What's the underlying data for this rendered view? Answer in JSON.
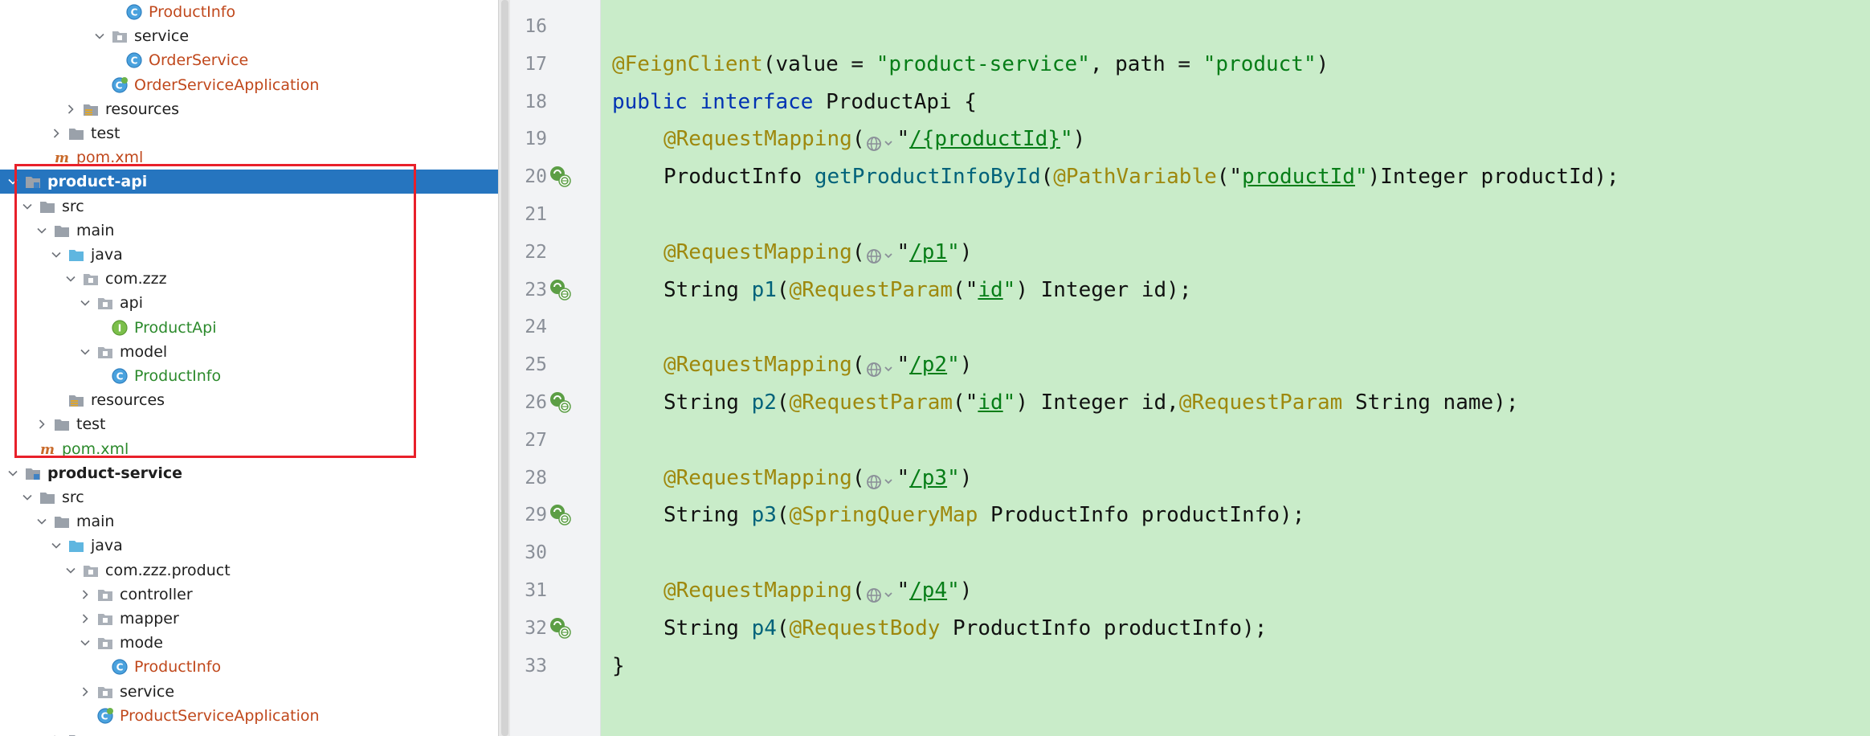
{
  "project_tree": {
    "rows": [
      {
        "label": "ProductInfo",
        "level": 7,
        "chevron": "none",
        "icon": "class-icon",
        "color": "cls-red"
      },
      {
        "label": "service",
        "level": 6,
        "chevron": "down",
        "icon": "package-icon",
        "color": "plain"
      },
      {
        "label": "OrderService",
        "level": 7,
        "chevron": "none",
        "icon": "class-icon",
        "color": "cls-red"
      },
      {
        "label": "OrderServiceApplication",
        "level": 6,
        "chevron": "none",
        "icon": "spring-app-icon",
        "color": "cls-red"
      },
      {
        "label": "resources",
        "level": 4,
        "chevron": "right",
        "icon": "resources-folder-icon",
        "color": "plain"
      },
      {
        "label": "test",
        "level": 3,
        "chevron": "right",
        "icon": "folder-icon",
        "color": "plain"
      },
      {
        "label": "pom.xml",
        "level": 2,
        "chevron": "none",
        "icon": "maven-icon",
        "color": "cls-red"
      },
      {
        "label": "product-api",
        "level": 0,
        "chevron": "down",
        "icon": "module-icon",
        "color": "plain",
        "selected": true,
        "bold": true
      },
      {
        "label": "src",
        "level": 1,
        "chevron": "down",
        "icon": "folder-icon",
        "color": "plain"
      },
      {
        "label": "main",
        "level": 2,
        "chevron": "down",
        "icon": "folder-icon",
        "color": "plain"
      },
      {
        "label": "java",
        "level": 3,
        "chevron": "down",
        "icon": "source-folder-icon",
        "color": "plain"
      },
      {
        "label": "com.zzz",
        "level": 4,
        "chevron": "down",
        "icon": "package-icon",
        "color": "plain"
      },
      {
        "label": "api",
        "level": 5,
        "chevron": "down",
        "icon": "package-icon",
        "color": "plain"
      },
      {
        "label": "ProductApi",
        "level": 6,
        "chevron": "none",
        "icon": "interface-icon",
        "color": "cls-green"
      },
      {
        "label": "model",
        "level": 5,
        "chevron": "down",
        "icon": "package-icon",
        "color": "plain"
      },
      {
        "label": "ProductInfo",
        "level": 6,
        "chevron": "none",
        "icon": "class-icon",
        "color": "cls-green"
      },
      {
        "label": "resources",
        "level": 3,
        "chevron": "none",
        "icon": "resources-folder-icon",
        "color": "plain"
      },
      {
        "label": "test",
        "level": 2,
        "chevron": "right",
        "icon": "folder-icon",
        "color": "plain"
      },
      {
        "label": "pom.xml",
        "level": 1,
        "chevron": "none",
        "icon": "maven-icon",
        "color": "cls-green"
      },
      {
        "label": "product-service",
        "level": 0,
        "chevron": "down",
        "icon": "module-icon",
        "color": "plain",
        "bold": true
      },
      {
        "label": "src",
        "level": 1,
        "chevron": "down",
        "icon": "folder-icon",
        "color": "plain"
      },
      {
        "label": "main",
        "level": 2,
        "chevron": "down",
        "icon": "folder-icon",
        "color": "plain"
      },
      {
        "label": "java",
        "level": 3,
        "chevron": "down",
        "icon": "source-folder-icon",
        "color": "plain"
      },
      {
        "label": "com.zzz.product",
        "level": 4,
        "chevron": "down",
        "icon": "package-icon",
        "color": "plain"
      },
      {
        "label": "controller",
        "level": 5,
        "chevron": "right",
        "icon": "package-icon",
        "color": "plain"
      },
      {
        "label": "mapper",
        "level": 5,
        "chevron": "right",
        "icon": "package-icon",
        "color": "plain"
      },
      {
        "label": "mode",
        "level": 5,
        "chevron": "down",
        "icon": "package-icon",
        "color": "plain"
      },
      {
        "label": "ProductInfo",
        "level": 6,
        "chevron": "none",
        "icon": "class-icon",
        "color": "cls-red"
      },
      {
        "label": "service",
        "level": 5,
        "chevron": "right",
        "icon": "package-icon",
        "color": "plain"
      },
      {
        "label": "ProductServiceApplication",
        "level": 5,
        "chevron": "none",
        "icon": "spring-app-icon",
        "color": "cls-red"
      },
      {
        "label": "resources",
        "level": 3,
        "chevron": "right",
        "icon": "resources-folder-icon",
        "color": "plain"
      }
    ]
  },
  "editor": {
    "lines": [
      {
        "num": "16",
        "marker": false,
        "indent": false,
        "tokens": []
      },
      {
        "num": "17",
        "marker": false,
        "indent": false,
        "tokens": [
          {
            "t": "@FeignClient",
            "c": "ann"
          },
          {
            "t": "(value = "
          },
          {
            "t": "\"product-service\"",
            "c": "str"
          },
          {
            "t": ", path = "
          },
          {
            "t": "\"product\"",
            "c": "str"
          },
          {
            "t": ")"
          }
        ]
      },
      {
        "num": "18",
        "marker": false,
        "indent": false,
        "tokens": [
          {
            "t": "public ",
            "c": "kw"
          },
          {
            "t": "interface ",
            "c": "kw"
          },
          {
            "t": "ProductApi {"
          }
        ]
      },
      {
        "num": "19",
        "marker": false,
        "indent": true,
        "tokens": [
          {
            "t": "@RequestMapping",
            "c": "ann"
          },
          {
            "t": "("
          },
          {
            "web": true
          },
          {
            "t": "\""
          },
          {
            "t": "/{productId}",
            "c": "strl"
          },
          {
            "t": "\"",
            "c": "str"
          },
          {
            "t": ")"
          }
        ]
      },
      {
        "num": "20",
        "marker": true,
        "indent": true,
        "tokens": [
          {
            "t": "ProductInfo "
          },
          {
            "t": "getProductInfoById",
            "c": "fn"
          },
          {
            "t": "("
          },
          {
            "t": "@PathVariable",
            "c": "ann"
          },
          {
            "t": "(\""
          },
          {
            "t": "productId",
            "c": "strl"
          },
          {
            "t": "\"",
            "c": "str"
          },
          {
            "t": ")Integer productId);"
          }
        ]
      },
      {
        "num": "21",
        "marker": false,
        "indent": false,
        "tokens": []
      },
      {
        "num": "22",
        "marker": false,
        "indent": true,
        "tokens": [
          {
            "t": "@RequestMapping",
            "c": "ann"
          },
          {
            "t": "("
          },
          {
            "web": true
          },
          {
            "t": "\""
          },
          {
            "t": "/p1",
            "c": "strl"
          },
          {
            "t": "\"",
            "c": "str"
          },
          {
            "t": ")"
          }
        ]
      },
      {
        "num": "23",
        "marker": true,
        "indent": true,
        "tokens": [
          {
            "t": "String "
          },
          {
            "t": "p1",
            "c": "fn"
          },
          {
            "t": "("
          },
          {
            "t": "@RequestParam",
            "c": "ann"
          },
          {
            "t": "(\""
          },
          {
            "t": "id",
            "c": "strl"
          },
          {
            "t": "\"",
            "c": "str"
          },
          {
            "t": ") Integer id);"
          }
        ]
      },
      {
        "num": "24",
        "marker": false,
        "indent": false,
        "tokens": []
      },
      {
        "num": "25",
        "marker": false,
        "indent": true,
        "tokens": [
          {
            "t": "@RequestMapping",
            "c": "ann"
          },
          {
            "t": "("
          },
          {
            "web": true
          },
          {
            "t": "\""
          },
          {
            "t": "/p2",
            "c": "strl"
          },
          {
            "t": "\"",
            "c": "str"
          },
          {
            "t": ")"
          }
        ]
      },
      {
        "num": "26",
        "marker": true,
        "indent": true,
        "tokens": [
          {
            "t": "String "
          },
          {
            "t": "p2",
            "c": "fn"
          },
          {
            "t": "("
          },
          {
            "t": "@RequestParam",
            "c": "ann"
          },
          {
            "t": "(\""
          },
          {
            "t": "id",
            "c": "strl"
          },
          {
            "t": "\"",
            "c": "str"
          },
          {
            "t": ") Integer id,"
          },
          {
            "t": "@RequestParam",
            "c": "ann"
          },
          {
            "t": " String name);"
          }
        ]
      },
      {
        "num": "27",
        "marker": false,
        "indent": false,
        "tokens": []
      },
      {
        "num": "28",
        "marker": false,
        "indent": true,
        "tokens": [
          {
            "t": "@RequestMapping",
            "c": "ann"
          },
          {
            "t": "("
          },
          {
            "web": true
          },
          {
            "t": "\""
          },
          {
            "t": "/p3",
            "c": "strl"
          },
          {
            "t": "\"",
            "c": "str"
          },
          {
            "t": ")"
          }
        ]
      },
      {
        "num": "29",
        "marker": true,
        "indent": true,
        "tokens": [
          {
            "t": "String "
          },
          {
            "t": "p3",
            "c": "fn"
          },
          {
            "t": "("
          },
          {
            "t": "@SpringQueryMap",
            "c": "ann"
          },
          {
            "t": " ProductInfo productInfo);"
          }
        ]
      },
      {
        "num": "30",
        "marker": false,
        "indent": false,
        "tokens": []
      },
      {
        "num": "31",
        "marker": false,
        "indent": true,
        "tokens": [
          {
            "t": "@RequestMapping",
            "c": "ann"
          },
          {
            "t": "("
          },
          {
            "web": true
          },
          {
            "t": "\""
          },
          {
            "t": "/p4",
            "c": "strl"
          },
          {
            "t": "\"",
            "c": "str"
          },
          {
            "t": ")"
          }
        ]
      },
      {
        "num": "32",
        "marker": true,
        "indent": true,
        "tokens": [
          {
            "t": "String "
          },
          {
            "t": "p4",
            "c": "fn"
          },
          {
            "t": "("
          },
          {
            "t": "@RequestBody",
            "c": "ann"
          },
          {
            "t": " ProductInfo productInfo);"
          }
        ]
      },
      {
        "num": "33",
        "marker": false,
        "indent": false,
        "tokens": [
          {
            "t": "}"
          }
        ]
      }
    ]
  },
  "colors": {
    "selection": "#2675bf",
    "highlight_box": "#e8202a",
    "editor_bg": "#c9ecc9",
    "annotation": "#9e880d",
    "keyword": "#0033b3",
    "string": "#067d17",
    "method": "#00627a"
  }
}
